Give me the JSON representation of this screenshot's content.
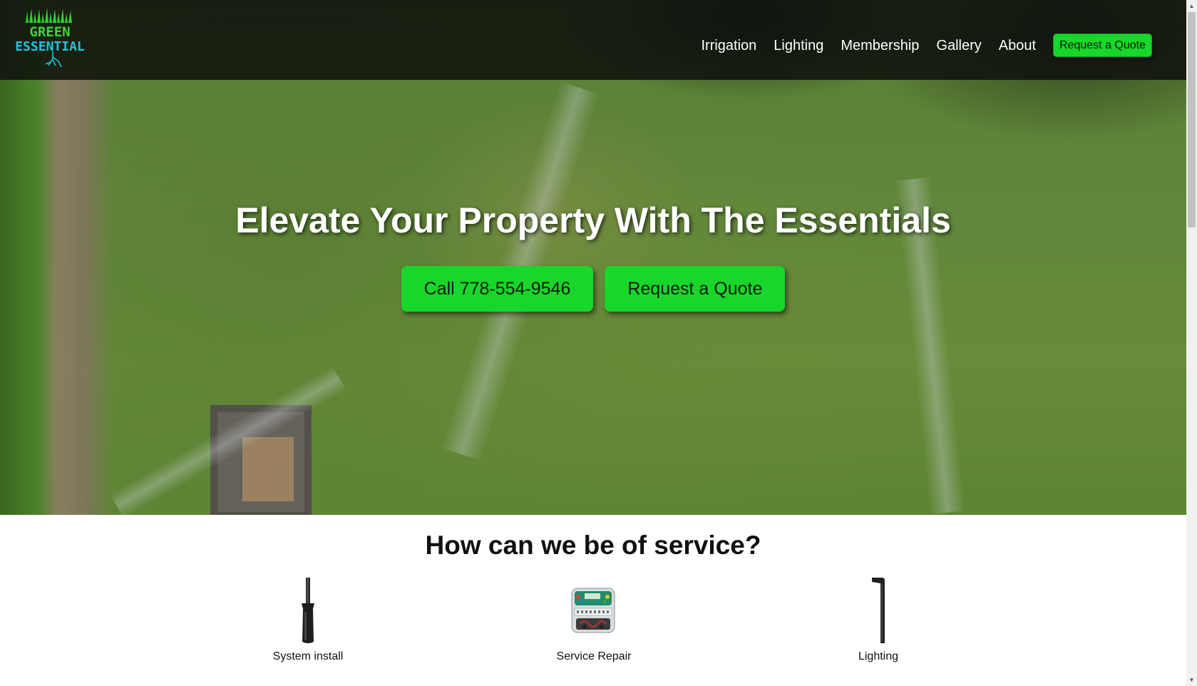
{
  "header": {
    "logo": {
      "line1": "GREEN",
      "line2": "ESSENTIAL",
      "colors": {
        "top": "#3ad43a",
        "bottom": "#1fc6d9"
      }
    },
    "nav": [
      {
        "label": "Irrigation"
      },
      {
        "label": "Lighting"
      },
      {
        "label": "Membership"
      },
      {
        "label": "Gallery"
      },
      {
        "label": "About"
      }
    ],
    "cta_label": "Request a Quote"
  },
  "hero": {
    "title": "Elevate Your Property With The Essentials",
    "buttons": {
      "call": "Call 778-554-9546",
      "quote": "Request a Quote"
    }
  },
  "services": {
    "title": "How can we be of service?",
    "items": [
      {
        "label": "System install",
        "icon": "sprinkler-head-icon"
      },
      {
        "label": "Service Repair",
        "icon": "irrigation-controller-icon"
      },
      {
        "label": "Lighting",
        "icon": "path-light-icon"
      }
    ]
  },
  "colors": {
    "accent": "#19d62a",
    "header_bg": "#0f120e"
  }
}
